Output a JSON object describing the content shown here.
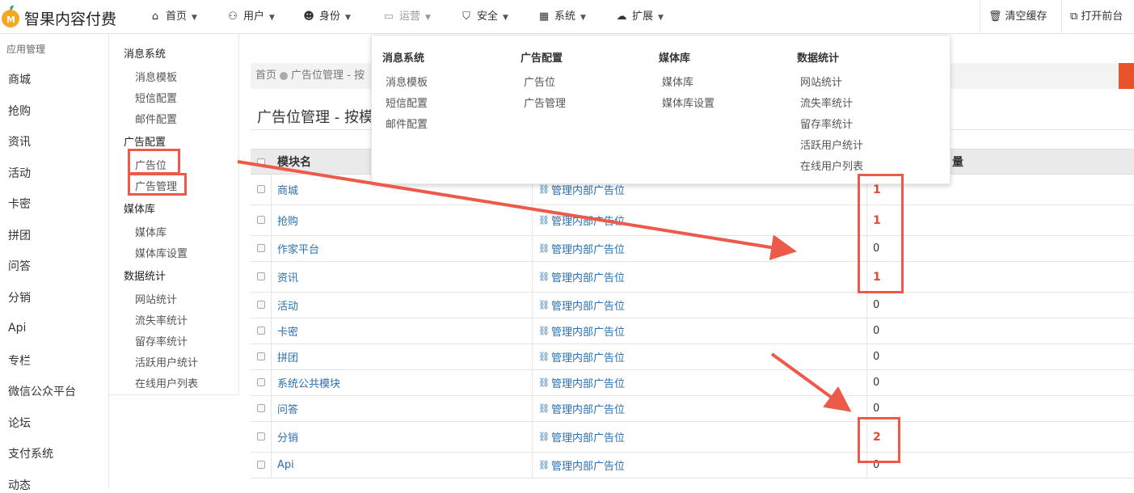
{
  "brand": {
    "name": "智果内容付费"
  },
  "nav": [
    {
      "label": "首页",
      "icon": "home-icon"
    },
    {
      "label": "用户",
      "icon": "user-icon"
    },
    {
      "label": "身份",
      "icon": "users-icon"
    },
    {
      "label": "运营",
      "icon": "monitor-icon",
      "state": "active"
    },
    {
      "label": "安全",
      "icon": "shield-icon"
    },
    {
      "label": "系统",
      "icon": "windows-icon"
    },
    {
      "label": "扩展",
      "icon": "cloud-icon"
    }
  ],
  "top_right": {
    "clear_cache": "清空缓存",
    "open_front": "打开前台"
  },
  "sidebar": {
    "heading": "应用管理",
    "items": [
      "商城",
      "抢购",
      "资讯",
      "活动",
      "卡密",
      "拼团",
      "问答",
      "分销",
      "Api",
      "专栏",
      "微信公众平台",
      "论坛",
      "支付系统",
      "动态"
    ]
  },
  "submenu": {
    "groups": [
      {
        "title": "消息系统",
        "links": [
          "消息模板",
          "短信配置",
          "邮件配置"
        ]
      },
      {
        "title": "广告配置",
        "links": [
          "广告位",
          "广告管理"
        ]
      },
      {
        "title": "媒体库",
        "links": [
          "媒体库",
          "媒体库设置"
        ]
      },
      {
        "title": "数据统计",
        "links": [
          "网站统计",
          "流失率统计",
          "留存率统计",
          "活跃用户统计",
          "在线用户列表"
        ]
      }
    ]
  },
  "dropdown": {
    "columns": [
      {
        "title": "消息系统",
        "links": [
          "消息模板",
          "短信配置",
          "邮件配置"
        ]
      },
      {
        "title": "广告配置",
        "links": [
          "广告位",
          "广告管理"
        ]
      },
      {
        "title": "媒体库",
        "links": [
          "媒体库",
          "媒体库设置"
        ]
      },
      {
        "title": "数据统计",
        "links": [
          "网站统计",
          "流失率统计",
          "留存率统计",
          "活跃用户统计",
          "在线用户列表"
        ]
      }
    ]
  },
  "breadcrumb": {
    "home": "首页",
    "current": "广告位管理 - 按"
  },
  "page_title": "广告位管理 - 按模",
  "table": {
    "headers": {
      "name": "模块名",
      "count": "量"
    },
    "rows": [
      {
        "name": "商城",
        "type": "管理内部广告位",
        "count": "1",
        "highlight": true
      },
      {
        "name": "抢购",
        "type": "管理内部广告位",
        "count": "1",
        "highlight": true
      },
      {
        "name": "作家平台",
        "type": "管理内部广告位",
        "count": "0",
        "highlight": false
      },
      {
        "name": "资讯",
        "type": "管理内部广告位",
        "count": "1",
        "highlight": true
      },
      {
        "name": "活动",
        "type": "管理内部广告位",
        "count": "0",
        "highlight": false
      },
      {
        "name": "卡密",
        "type": "管理内部广告位",
        "count": "0",
        "highlight": false
      },
      {
        "name": "拼团",
        "type": "管理内部广告位",
        "count": "0",
        "highlight": false
      },
      {
        "name": "系统公共模块",
        "type": "管理内部广告位",
        "count": "0",
        "highlight": false
      },
      {
        "name": "问答",
        "type": "管理内部广告位",
        "count": "0",
        "highlight": false
      },
      {
        "name": "分销",
        "type": "管理内部广告位",
        "count": "2",
        "highlight": true
      },
      {
        "name": "Api",
        "type": "管理内部广告位",
        "count": "0",
        "highlight": false
      }
    ]
  },
  "colors": {
    "accent": "#e8532c",
    "link": "#2a6fb0",
    "annotation": "#ee5a4a"
  }
}
